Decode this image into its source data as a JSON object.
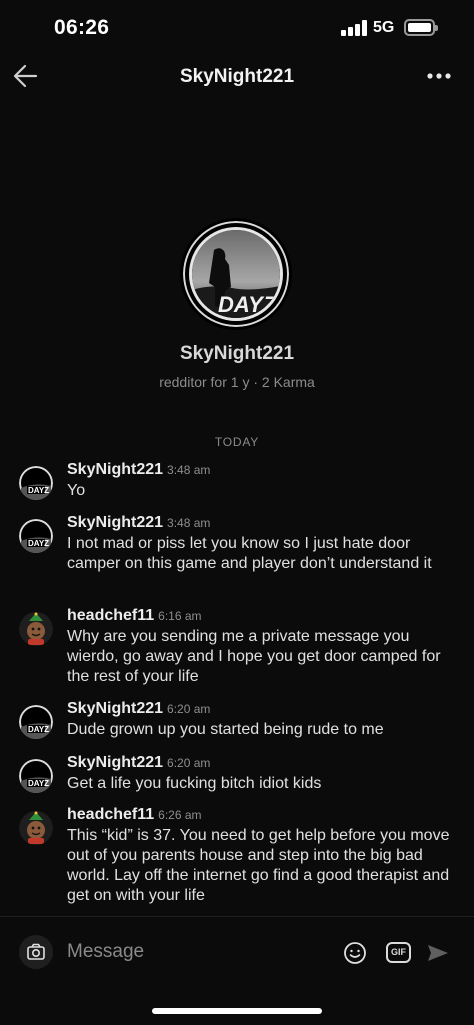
{
  "status_bar": {
    "time": "06:26",
    "network": "5G",
    "icons": [
      "signal-icon",
      "battery-icon"
    ]
  },
  "header": {
    "title": "SkyNight221",
    "back_icon": "arrow-left-icon",
    "more_icon": "more-horizontal-icon"
  },
  "profile": {
    "name": "SkyNight221",
    "meta": "redditor for 1 y · 2 Karma",
    "avatar_logo": "DAYZ"
  },
  "date_divider": "TODAY",
  "messages": [
    {
      "author": "SkyNight221",
      "time": "3:48 am",
      "text": "Yo"
    },
    {
      "author": "SkyNight221",
      "time": "3:48 am",
      "text": "I not mad or piss let you know so I just hate door camper on this game and player don’t understand it"
    },
    {
      "author": "headchef11",
      "time": "6:16 am",
      "text": "Why are you sending me a private message you wierdo, go away and I hope you get door camped for the rest of your life"
    },
    {
      "author": "SkyNight221",
      "time": "6:20 am",
      "text": "Dude grown up you started being rude to me"
    },
    {
      "author": "SkyNight221",
      "time": "6:20 am",
      "text": "Get a life you fucking bitch idiot kids"
    },
    {
      "author": "headchef11",
      "time": "6:26 am",
      "text": "This “kid” is 37. You need to get help before you move out of you parents house and step into the big bad world. Lay off the internet go find a good therapist and get on with your life"
    }
  ],
  "composer": {
    "placeholder": "Message",
    "gif_label": "GIF",
    "icons": [
      "camera-icon",
      "emoji-icon",
      "send-icon"
    ]
  },
  "colors": {
    "background": "#0b0b0b",
    "text": "#e0e0e0",
    "muted": "#8c8c8c"
  }
}
